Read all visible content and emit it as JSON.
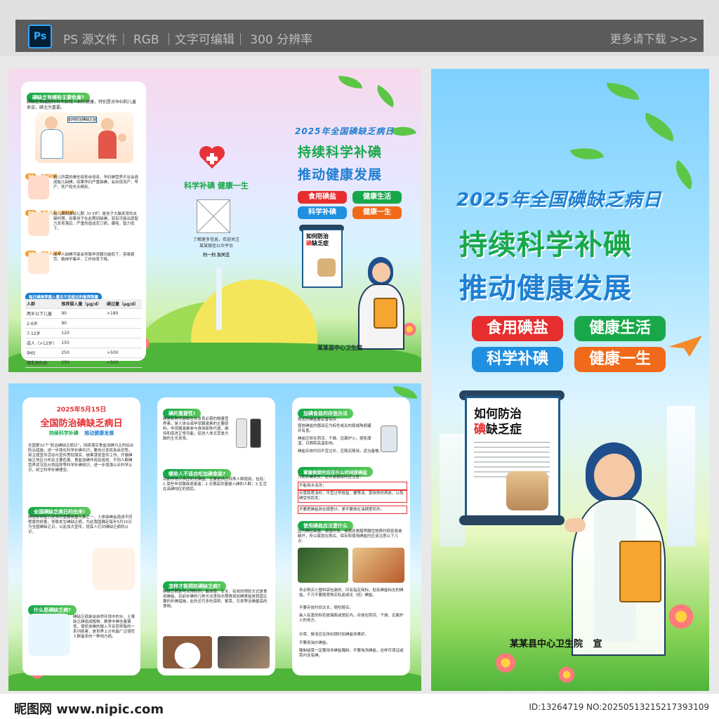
{
  "top": {
    "ps_badge": "Ps",
    "caption": "PS 源文件｜ RGB ｜文字可编辑｜ 300 分辨率",
    "more": "更多请下载 >>>"
  },
  "cover": {
    "date_title": "2025年全国碘缺乏病日",
    "slogan_line1": "持续科学补碘",
    "slogan_line2": "推动健康发展",
    "tags": [
      "食用碘盐",
      "健康生活",
      "科学补碘",
      "健康一生"
    ],
    "scroll_title_1": "如何防治",
    "scroll_title_2a": "碘",
    "scroll_title_2b": "缺乏症",
    "publisher": "某某县中心卫生院",
    "publisher_suffix": "宣"
  },
  "inner_back": {
    "heart_caption": "科学补碘 健康一生",
    "qr_note": "了解更多信息，欢迎关注\n某某微信公众平台",
    "qr_scan": "扫一扫 加关注",
    "date_title": "2025年全国碘缺乏病日",
    "slogan_line1": "持续科学补碘",
    "slogan_line2": "推动健康发展",
    "tags": [
      "食用碘盐",
      "健康生活",
      "科学补碘",
      "健康一生"
    ],
    "scroll_title_1": "如何防治",
    "scroll_title_2a": "碘",
    "scroll_title_2b": "缺乏症",
    "publisher": "某某县中心卫生院"
  },
  "hazards": {
    "heading": "碘缺乏有哪些主要危害?",
    "intro": "碘缺乏病威胁所有年龄段人群的健康，特别是对孕妇和儿童来说，碘尤为重要。",
    "poster_label": "如何防治碘缺乏症",
    "items": [
      {
        "num": "01",
        "title": "孕期缺碘",
        "text": "胎儿所需的碘全部来自母亲，孕妇碘营养不足会造成胎儿缺碘，如果孕妇严重缺碘，会出现流产、早产、死产和先天畸形。"
      },
      {
        "num": "02",
        "title": "新生儿及儿童缺碘",
        "text": "胎儿期和婴幼儿期（0-3岁）是孩子大脑发育的关键时期，如果孩子在此期间缺碘，就有可能出现智力发育落后，严重的造成克汀病，聋哑、智力低下。"
      },
      {
        "num": "03",
        "title": "成年人缺碘",
        "text": "成年人缺碘可能会导致甲状腺功能低下，容易疲劳、精神不集中、工作效率下降。"
      }
    ],
    "table_heading": "每日碘推荐摄入量及不宜超过的推荐限量",
    "table_head": [
      "人群",
      "推荐摄入量（μg/d）",
      "碘过量（μg/d）"
    ],
    "table_rows": [
      [
        "两岁以下儿童",
        "90",
        ">180"
      ],
      [
        "2-6岁",
        "90",
        ""
      ],
      [
        "7-12岁",
        "120",
        ""
      ],
      [
        "成人（>12岁）",
        "150",
        ""
      ],
      [
        "孕妇",
        "250",
        ">500"
      ],
      [
        "哺乳期妇女",
        "250",
        ">500"
      ]
    ]
  },
  "inside": {
    "col1": {
      "date": "2025年5月15日",
      "title": "全国防治碘缺乏病日",
      "sub1": "持续科学补碘",
      "sub2": "推动健康发展",
      "intro": "全国第32个“防治碘缺乏病日”，持续落实食盐加碘为主的综合防治措施，进一步强化科学补碘共识，要充分发挥各自优势，将主题宣传活动与宣传贯彻落实、统筹谋划宣传工作，开展碘缺乏地区分布及主要危害、食盐加碘作用及成效、不同人群碘营养状况及分类指导等科学补碘知识，进一步增强公众科学认识，树立科学补碘理念。",
      "origin_heading": "全国碘缺乏病日的由来!",
      "origin_text": "碘是影响智力发育的重要微量元素之一，人体缺碘会造成不同程度的损害，导致发生碘缺乏病，为此我国确定每年5月15日为全国碘缺乏日，以此加大宣传，提高人们对碘缺乏病的认识。",
      "what_heading": "什么是碘缺乏病?",
      "what_text": "碘缺乏病是由自然环境中的水、土壤缺乏碘造成植物、粮食中碘含量偏低，使机体碘的摄入不足而导致的一系列损害，是世界上分布最广泛侵犯人群最多的一种地方病。"
    },
    "col2": {
      "h1": "碘的重要性!",
      "t1": "碘是新陈代谢和生长发育必需的微量营养素，是人体合成甲状腺激素的主要原料。甲状腺激素参与身体新陈代谢，维持和促进正常功能，促进人体尤其是大脑的生长发育。",
      "h2": "哪些人不适合吃加碘食盐?",
      "t2": "目前市场上供应的无碘盐，主要是供应特殊人群使用，包括：1.某些甲状腺疾病患者；2.长期高剂量摄入碘的人群；3.生活在高碘地区的居民。",
      "h3": "怎样才能预防碘缺乏病?",
      "t3": "碘缺乏病是可以预防的，最简便、安全、有效的预防方式是食用碘盐。目前补碘的几种方法坚持长期食用加碘食盐是我国主要的补碘措施，此外还可多吃海带、紫菜、贝类等含碘量高的食物。"
    },
    "col3": {
      "h1": "加碘食盐的存放办法",
      "t1": "购买的碘盐要妥善保存：",
      "list1": [
        "盛放碘盐的器皿应为棕色或关的瓶或陶瓷罐并有盖。",
        "碘盐应放在阴凉、干燥、远离炉火，避免潮湿，日晒和高温影响。",
        "碘盐存放时间不宜过长，应随买随用，适当备餐。"
      ],
      "h2": "掌握做菜时应在什么时间放碘盐",
      "t2": "为防止碘丢失，在炒菜做饭时应注意：",
      "list2": [
        "不能用水泡洗；",
        "炒菜和煮汤时，不宜过早放盐，要等汤、菜快熟时再放，以免碘受热挥发；",
        "不要把碘盐放在锅里炒，更不要放在油锅里煎炸。"
      ],
      "h3": "使用碘盐应注意什么",
      "t3": "因为碘在高温、潮湿环境、或遇到食醋等酸性物质时很容易被破坏，所以家庭在购买、保存和使用碘盐时应该注意以下几点：",
      "list3": [
        "务必购买小塑料袋包装的、印有指定商标、贴有碘盐标志的碘盐，千万不要随意购买私盐或无（低）碘盐。",
        "不要存放时间太长，随吃随买。",
        "装入有盖的棕色玻璃瓶或瓷缸内，存放在阴凉、干燥、远离炉火的地方。",
        "炒菜、做汤应在快出锅时加碘盐效果好。",
        "不要用油炒碘盐。",
        "腌制咸菜一定要用非碘盐腌制，不要淘洗碘盐，这样可保证咸菜内含有碘。"
      ]
    }
  },
  "watermark": {
    "left": "昵图网 www.nipic.com",
    "right": "ID:13264719 NO:20250513215217393109"
  },
  "colors": {
    "green": "#18a84a",
    "red": "#e62e2e",
    "blue": "#1f8fe0",
    "orange": "#f06a1a"
  }
}
